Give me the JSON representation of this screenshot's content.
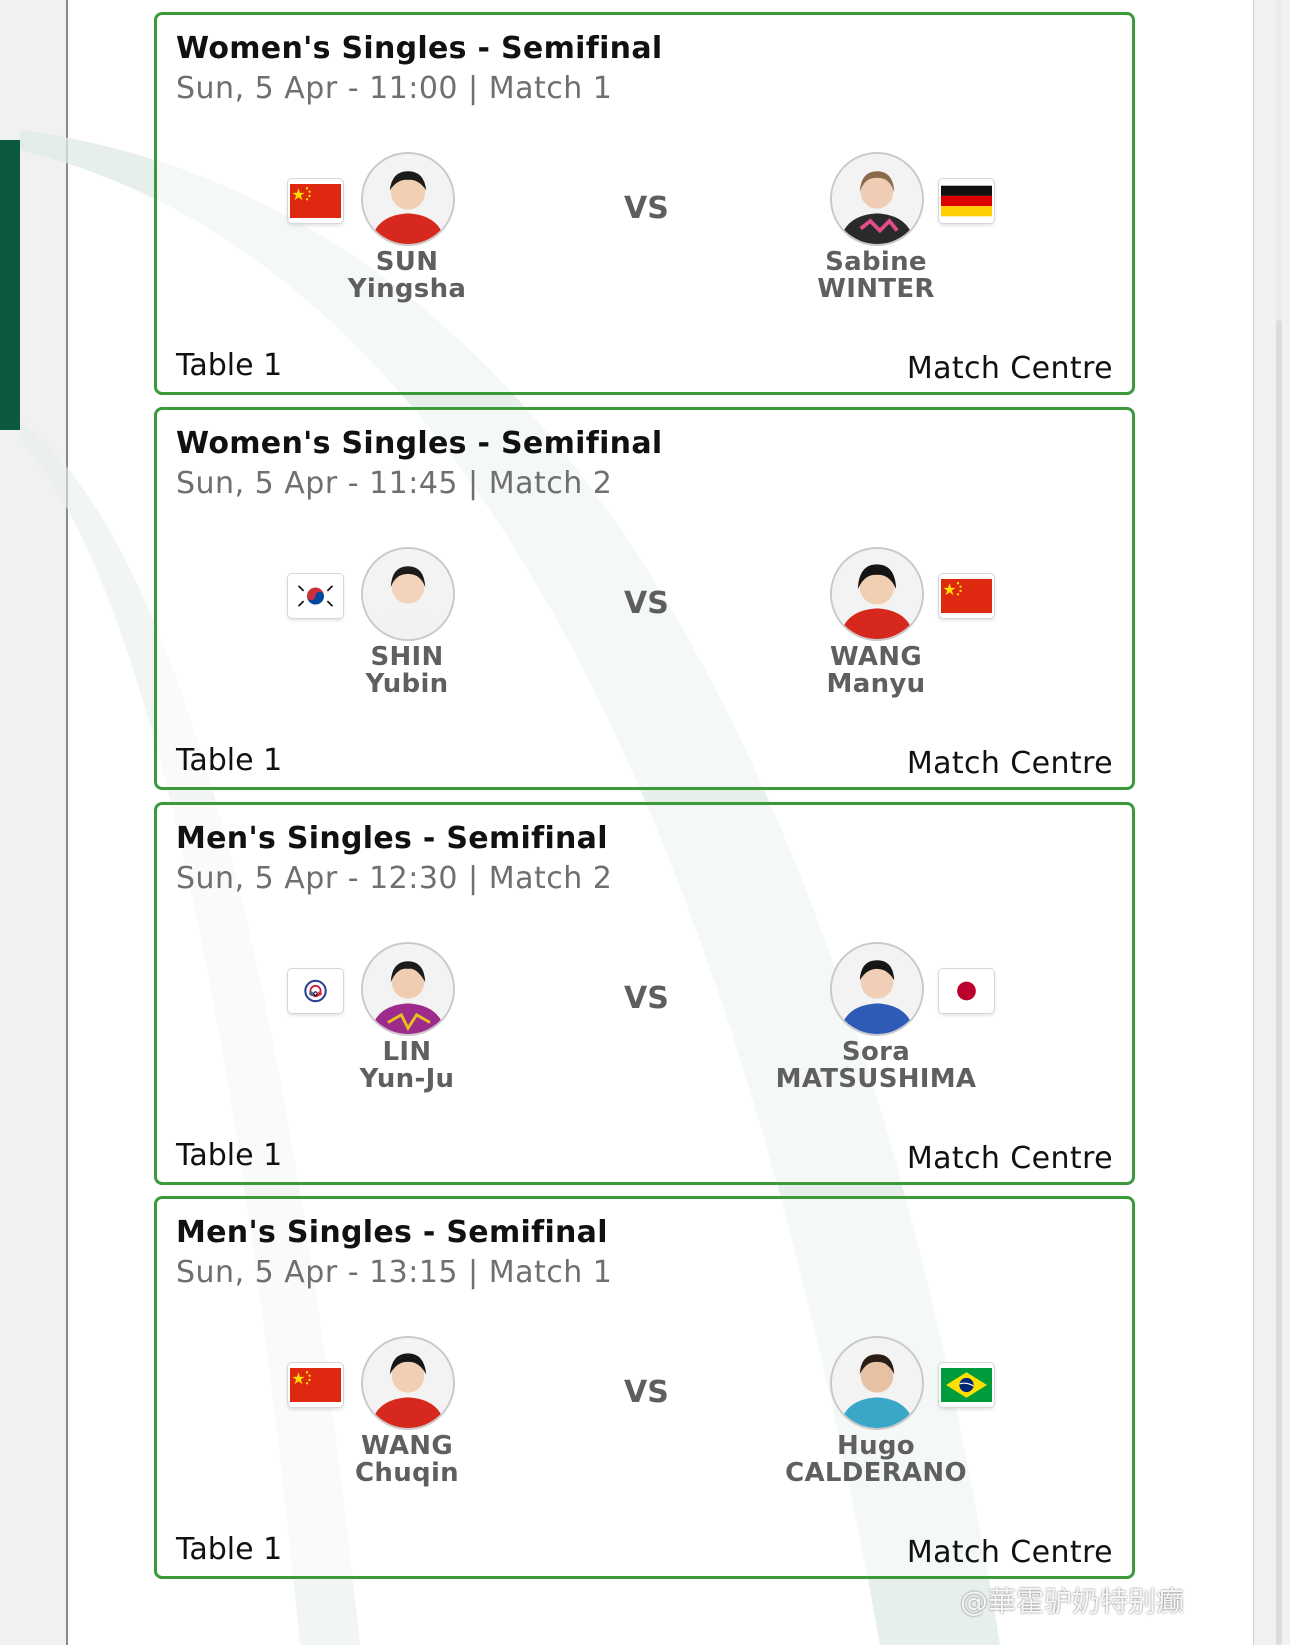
{
  "vs_label": "VS",
  "theme": {
    "card_border": "#3c9a3a",
    "brand_green": "#0b5a3e",
    "swoosh": "#dfe9e4"
  },
  "matches": [
    {
      "event": "Women's Singles - Semifinal",
      "meta": "Sun, 5 Apr - 11:00 | Match 1",
      "table": "Table 1",
      "link": "Match Centre",
      "left": {
        "first": "SUN",
        "last": "Yingsha",
        "flag": "china-flag",
        "shirt": "#d6281c"
      },
      "right": {
        "first": "Sabine",
        "last": "WINTER",
        "flag": "germany-flag",
        "shirt": "#2a2a2a"
      }
    },
    {
      "event": "Women's Singles - Semifinal",
      "meta": "Sun, 5 Apr - 11:45 | Match 2",
      "table": "Table 1",
      "link": "Match Centre",
      "left": {
        "first": "SHIN",
        "last": "Yubin",
        "flag": "korea-flag",
        "shirt": "#f2f2f4"
      },
      "right": {
        "first": "WANG",
        "last": "Manyu",
        "flag": "china-flag",
        "shirt": "#d6281c"
      }
    },
    {
      "event": "Men's Singles - Semifinal",
      "meta": "Sun, 5 Apr - 12:30 | Match 2",
      "table": "Table 1",
      "link": "Match Centre",
      "left": {
        "first": "LIN",
        "last": "Yun-Ju",
        "flag": "chinese-taipei-flag",
        "shirt": "#9c2b8c"
      },
      "right": {
        "first": "Sora",
        "last": "MATSUSHIMA",
        "flag": "japan-flag",
        "shirt": "#2f5bb8"
      }
    },
    {
      "event": "Men's Singles - Semifinal",
      "meta": "Sun, 5 Apr - 13:15 | Match 1",
      "table": "Table 1",
      "link": "Match Centre",
      "left": {
        "first": "WANG",
        "last": "Chuqin",
        "flag": "china-flag",
        "shirt": "#d6281c"
      },
      "right": {
        "first": "Hugo",
        "last": "CALDERANO",
        "flag": "brazil-flag",
        "shirt": "#3aa7c9"
      }
    }
  ],
  "watermark": "@華霍驴奶特别癫"
}
